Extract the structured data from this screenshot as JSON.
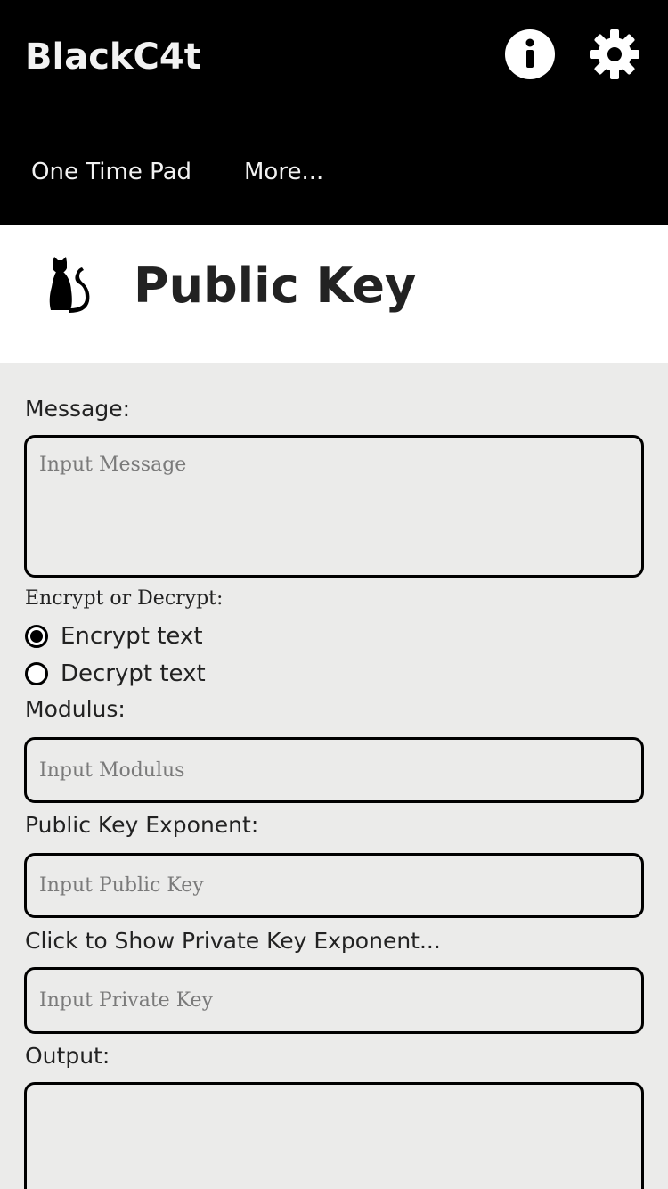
{
  "header": {
    "brand": "BlackC4t",
    "icons": {
      "info": "info-icon",
      "settings": "gear-icon"
    },
    "nav": {
      "one_time_pad": "One Time Pad",
      "more": "More..."
    }
  },
  "title": {
    "icon": "cat-icon",
    "text": "Public Key"
  },
  "form": {
    "message_label": "Message:",
    "message_placeholder": "Input Message",
    "mode_label": "Encrypt or Decrypt:",
    "encrypt_label": "Encrypt text",
    "decrypt_label": "Decrypt text",
    "selected_mode": "encrypt",
    "modulus_label": "Modulus:",
    "modulus_placeholder": "Input Modulus",
    "public_exp_label": "Public Key Exponent:",
    "public_exp_placeholder": "Input Public Key",
    "private_toggle_label": "Click to Show Private Key Exponent...",
    "private_placeholder": "Input Private Key",
    "output_label": "Output:"
  },
  "colors": {
    "header_bg": "#000000",
    "page_bg": "#ebebea",
    "text": "#222222"
  }
}
